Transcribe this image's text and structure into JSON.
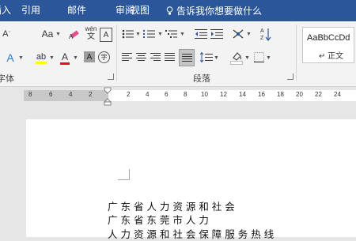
{
  "tabs": [
    {
      "label": "插入"
    },
    {
      "label": "引用"
    },
    {
      "label": "邮件"
    },
    {
      "label": "审阅"
    },
    {
      "label": "视图"
    }
  ],
  "tell_me": {
    "text": "告诉我你想要做什么"
  },
  "groups": {
    "font": {
      "label": "字体"
    },
    "paragraph": {
      "label": "段落"
    }
  },
  "font_buttons": {
    "font_case": "Aa",
    "font_color_letter": "A",
    "char_shading": "A",
    "pinyin_top": "wén",
    "pinyin_bottom": "文",
    "enclose": "字"
  },
  "styles": {
    "sample": "AaBbCcDd",
    "name": "↵ 正文"
  },
  "ruler": {
    "left_numbers": [
      "8",
      "6",
      "4",
      "2",
      "2"
    ],
    "right_numbers": [
      "2",
      "4",
      "6",
      "8",
      "10",
      "12",
      "14",
      "16",
      "18",
      "20",
      "22",
      "24"
    ]
  },
  "document": {
    "lines": [
      "广  东  省  人  力  资  源  和  社  会",
      "广   东   省   东   莞   市   人   力",
      "人 力 资 源 和 社 会 保 障 服 务 热 线"
    ]
  },
  "colors": {
    "accent": "#2b579a",
    "font_color_red": "#e81123",
    "highlight_yellow": "#ffff00"
  }
}
